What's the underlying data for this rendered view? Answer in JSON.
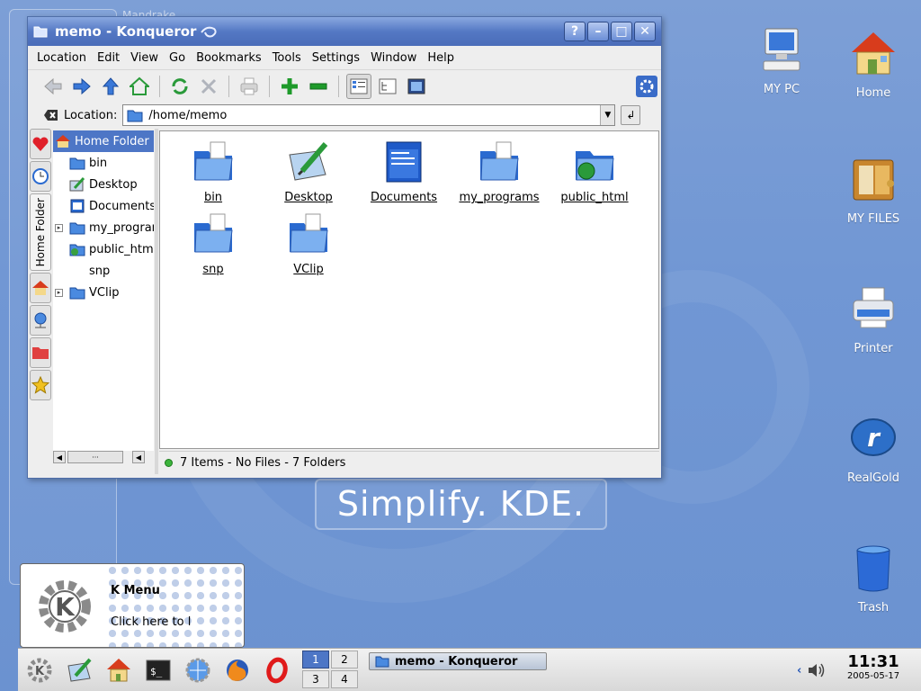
{
  "window": {
    "title": "memo - Konqueror",
    "buttons": {
      "help": "?",
      "minimize": "–",
      "maximize": "□",
      "close": "✕"
    }
  },
  "menubar": [
    {
      "label": "Location"
    },
    {
      "label": "Edit"
    },
    {
      "label": "View"
    },
    {
      "label": "Go"
    },
    {
      "label": "Bookmarks"
    },
    {
      "label": "Tools"
    },
    {
      "label": "Settings"
    },
    {
      "label": "Window"
    },
    {
      "label": "Help"
    }
  ],
  "location": {
    "label": "Location:",
    "value": "/home/memo"
  },
  "sidebar_tab_label": "Home Folder",
  "tree": [
    {
      "label": "Home Folder"
    },
    {
      "label": "bin"
    },
    {
      "label": "Desktop"
    },
    {
      "label": "Documents"
    },
    {
      "label": "my_programs"
    },
    {
      "label": "public_html"
    },
    {
      "label": "snp"
    },
    {
      "label": "VClip"
    }
  ],
  "files": [
    {
      "name": "bin"
    },
    {
      "name": "Desktop"
    },
    {
      "name": "Documents"
    },
    {
      "name": "my_programs"
    },
    {
      "name": "public_html"
    },
    {
      "name": "snp"
    },
    {
      "name": "VClip"
    }
  ],
  "status": "7 Items - No Files - 7 Folders",
  "desktop_icons": [
    {
      "label": "MY PC"
    },
    {
      "label": "Home"
    },
    {
      "label": "MY FILES"
    },
    {
      "label": "Printer"
    },
    {
      "label": "RealGold"
    },
    {
      "label": "Trash"
    }
  ],
  "slogan": "Simplify. KDE.",
  "bg_title": "Mandrake",
  "kmenu_tip": {
    "title": "K Menu",
    "desc": "Click here to l"
  },
  "pager": [
    "1",
    "2",
    "3",
    "4"
  ],
  "taskbar_task": "memo - Konqueror",
  "clock": {
    "time": "11:31",
    "date": "2005-05-17"
  },
  "colors": {
    "accent": "#4d76c6",
    "desktop": "#7197d4"
  }
}
